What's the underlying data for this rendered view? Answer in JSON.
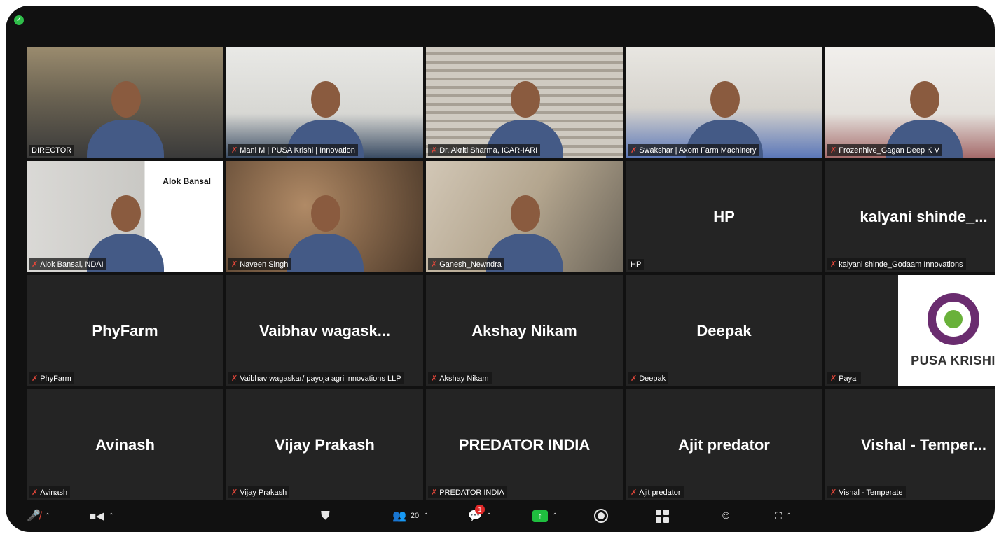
{
  "tiles": [
    {
      "label": "DIRECTOR",
      "center": "",
      "muted": false,
      "active": true,
      "video": "v1"
    },
    {
      "label": "Mani M | PUSA Krishi | Innovation",
      "center": "",
      "muted": true,
      "active": false,
      "video": "v2"
    },
    {
      "label": "Dr. Akriti Sharma, ICAR-IARI",
      "center": "",
      "muted": true,
      "active": false,
      "video": "v3"
    },
    {
      "label": "Swakshar | Axom Farm Machinery",
      "center": "",
      "muted": true,
      "active": false,
      "video": "v4"
    },
    {
      "label": "Frozenhive_Gagan Deep K V",
      "center": "",
      "muted": true,
      "active": false,
      "video": "v5"
    },
    {
      "label": "Alok Bansal, NDAI",
      "center": "",
      "muted": true,
      "active": false,
      "video": "v6",
      "overlay_text": "Alok Bansal"
    },
    {
      "label": "Naveen Singh",
      "center": "",
      "muted": true,
      "active": false,
      "video": "v7"
    },
    {
      "label": "Ganesh_Newndra",
      "center": "",
      "muted": true,
      "active": false,
      "video": "v8"
    },
    {
      "label": "HP",
      "center": "HP",
      "muted": false,
      "active": false,
      "video": ""
    },
    {
      "label": "kalyani shinde_Godaam Innovations",
      "center": "kalyani  shinde_...",
      "muted": true,
      "active": false,
      "video": ""
    },
    {
      "label": "PhyFarm",
      "center": "PhyFarm",
      "muted": true,
      "active": false,
      "video": ""
    },
    {
      "label": "Vaibhav wagaskar/ payoja agri innovations LLP",
      "center": "Vaibhav  wagask...",
      "muted": true,
      "active": false,
      "video": ""
    },
    {
      "label": "Akshay Nikam",
      "center": "Akshay Nikam",
      "muted": true,
      "active": false,
      "video": ""
    },
    {
      "label": "Deepak",
      "center": "Deepak",
      "muted": true,
      "active": false,
      "video": ""
    },
    {
      "label": "Payal",
      "center": "",
      "muted": true,
      "active": false,
      "video": "",
      "logo_text": "PUSA KRISHI"
    },
    {
      "label": "Avinash",
      "center": "Avinash",
      "muted": true,
      "active": false,
      "video": ""
    },
    {
      "label": "Vijay Prakash",
      "center": "Vijay Prakash",
      "muted": true,
      "active": false,
      "video": ""
    },
    {
      "label": "PREDATOR INDIA",
      "center": "PREDATOR INDIA",
      "muted": true,
      "active": false,
      "video": ""
    },
    {
      "label": "Ajit predator",
      "center": "Ajit predator",
      "muted": true,
      "active": false,
      "video": ""
    },
    {
      "label": "Vishal - Temperate",
      "center": "Vishal  -  Temper...",
      "muted": true,
      "active": false,
      "video": ""
    }
  ],
  "toolbar": {
    "participants_count": "20",
    "chat_badge": "1"
  },
  "colors": {
    "background": "#111111",
    "tile": "#242424",
    "active_outline": "#d8f06a",
    "muted_icon": "#e5473a",
    "share_green": "#1fbf3f"
  }
}
